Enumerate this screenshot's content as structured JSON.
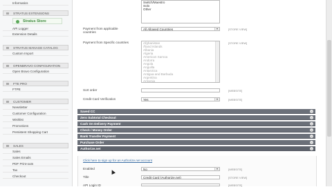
{
  "sidebar": {
    "top_item": "Informatics",
    "groups": [
      {
        "title": "Stratus Extensions",
        "items": [
          "API Logger",
          "Extension Details"
        ]
      },
      {
        "title": "Stratus Manage Catalog",
        "items": [
          "Custom Import"
        ]
      },
      {
        "title": "Openbravo Configuration",
        "items": [
          "Open Bravo Configuration"
        ]
      },
      {
        "title": "FTE PRO",
        "items": [
          "FTPE"
        ]
      },
      {
        "title": "Customer",
        "items": [
          "Newsletter",
          "Customer Configuration",
          "Wishlist",
          "Promotions",
          "Persistent Shopping Cart"
        ]
      },
      {
        "title": "Sales",
        "items": [
          "Sales",
          "Sales Emails",
          "PDF Print-outs",
          "Tax",
          "Checkout"
        ]
      }
    ],
    "logo_text": "Stratus Store"
  },
  "form": {
    "top_list_options": [
      "Switch/Maestro",
      "Solo",
      "Other"
    ],
    "payment_from_applicable": {
      "label_line1": "Payment from applicable",
      "label_line2": "countries",
      "value": "All Allowed Countries",
      "scope": "[STORE VIEW]"
    },
    "payment_from_specific": {
      "label": "Payment from Specific countries",
      "scope": "[STORE VIEW]",
      "options": [
        "Afghanistan",
        "Åland Islands",
        "Albania",
        "Algeria",
        "American Samoa",
        "Andorra",
        "Angola",
        "Anguilla",
        "Antarctica",
        "Antigua and Barbuda",
        "Argentina",
        "Armenia",
        "Aruba",
        "Australia",
        "Austria"
      ]
    },
    "sort_order": {
      "label": "Sort order",
      "value": "",
      "scope": "[WEBSITE]"
    },
    "credit_card_verification": {
      "label": "Credit Card Verification",
      "value": "Yes",
      "scope": "[WEBSITE]"
    }
  },
  "payment_sections": [
    "Saved CC",
    "Zero Subtotal Checkout",
    "Cash On Delivery Payment",
    "Check / Money Order",
    "Bank Transfer Payment",
    "Purchase Order",
    "Authorize.net"
  ],
  "authorize_net": {
    "link_text": "Click here to sign up for an Authorize.net account",
    "enabled": {
      "label": "Enabled",
      "value": "No",
      "scope": "[WEBSITE]"
    },
    "title": {
      "label": "Title",
      "value": "Credit Card (Authorize.net)",
      "scope": "[STORE VIEW]"
    },
    "api_login": {
      "label": "API Login ID",
      "value": "",
      "scope": "[WEBSITE]"
    }
  }
}
